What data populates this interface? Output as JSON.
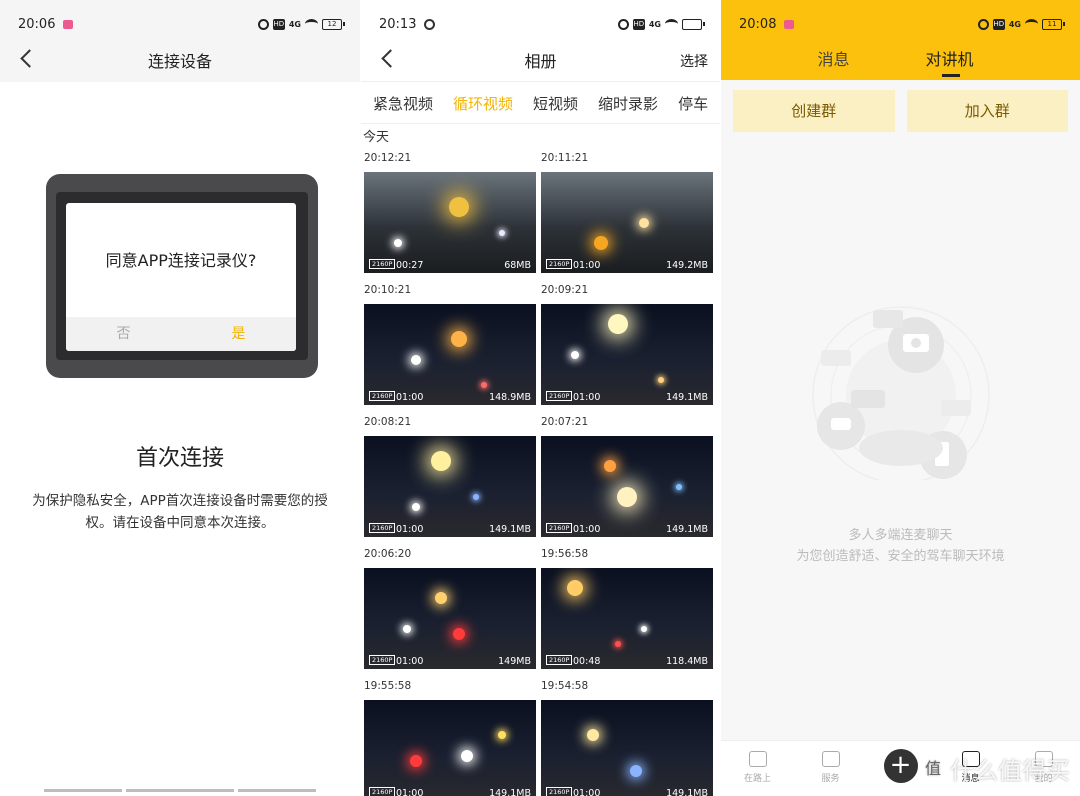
{
  "panel1": {
    "status": {
      "time": "20:06",
      "battery": "12"
    },
    "nav": {
      "title": "连接设备",
      "back_icon": "chevron-left-icon"
    },
    "dialog": {
      "question": "同意APP连接记录仪?",
      "no": "否",
      "yes": "是"
    },
    "heading": "首次连接",
    "description": "为保护隐私安全，APP首次连接设备时需要您的授权。请在设备中同意本次连接。",
    "accent": "#f4b400"
  },
  "panel2": {
    "status": {
      "time": "20:13"
    },
    "nav": {
      "title": "相册",
      "action": "选择"
    },
    "tabs": [
      {
        "label": "紧急视频",
        "active": false
      },
      {
        "label": "循环视频",
        "active": true
      },
      {
        "label": "短视频",
        "active": false
      },
      {
        "label": "缩时录影",
        "active": false
      },
      {
        "label": "停车",
        "active": false
      }
    ],
    "day": "今天",
    "videos": [
      {
        "time": "20:12:21",
        "res": "2160P",
        "duration": "00:27",
        "size": "68MB"
      },
      {
        "time": "20:11:21",
        "res": "2160P",
        "duration": "01:00",
        "size": "149.2MB"
      },
      {
        "time": "20:10:21",
        "res": "2160P",
        "duration": "01:00",
        "size": "148.9MB"
      },
      {
        "time": "20:09:21",
        "res": "2160P",
        "duration": "01:00",
        "size": "149.1MB"
      },
      {
        "time": "20:08:21",
        "res": "2160P",
        "duration": "01:00",
        "size": "149.1MB"
      },
      {
        "time": "20:07:21",
        "res": "2160P",
        "duration": "01:00",
        "size": "149.1MB"
      },
      {
        "time": "20:06:20",
        "res": "2160P",
        "duration": "01:00",
        "size": "149MB"
      },
      {
        "time": "19:56:58",
        "res": "2160P",
        "duration": "00:48",
        "size": "118.4MB"
      },
      {
        "time": "19:55:58",
        "res": "2160P",
        "duration": "01:00",
        "size": "149.1MB"
      },
      {
        "time": "19:54:58",
        "res": "2160P",
        "duration": "01:00",
        "size": "149.1MB"
      }
    ]
  },
  "panel3": {
    "status": {
      "time": "20:08",
      "battery": "11"
    },
    "tabs": [
      "消息",
      "对讲机"
    ],
    "active_tab": "对讲机",
    "actions": [
      "创建群",
      "加入群"
    ],
    "empty_title": "多人多端连麦聊天",
    "empty_sub": "为您创造舒适、安全的驾车聊天环境",
    "tabbar": [
      {
        "label": "在路上",
        "icon": "home-icon"
      },
      {
        "label": "服务",
        "icon": "car-icon"
      },
      {
        "label": "",
        "icon": "plus-icon"
      },
      {
        "label": "消息",
        "icon": "message-icon",
        "active": true
      },
      {
        "label": "我的",
        "icon": "profile-icon"
      }
    ],
    "brand_color": "#fcc10c"
  },
  "watermark": {
    "text": "什么值得买",
    "icon": "值"
  }
}
